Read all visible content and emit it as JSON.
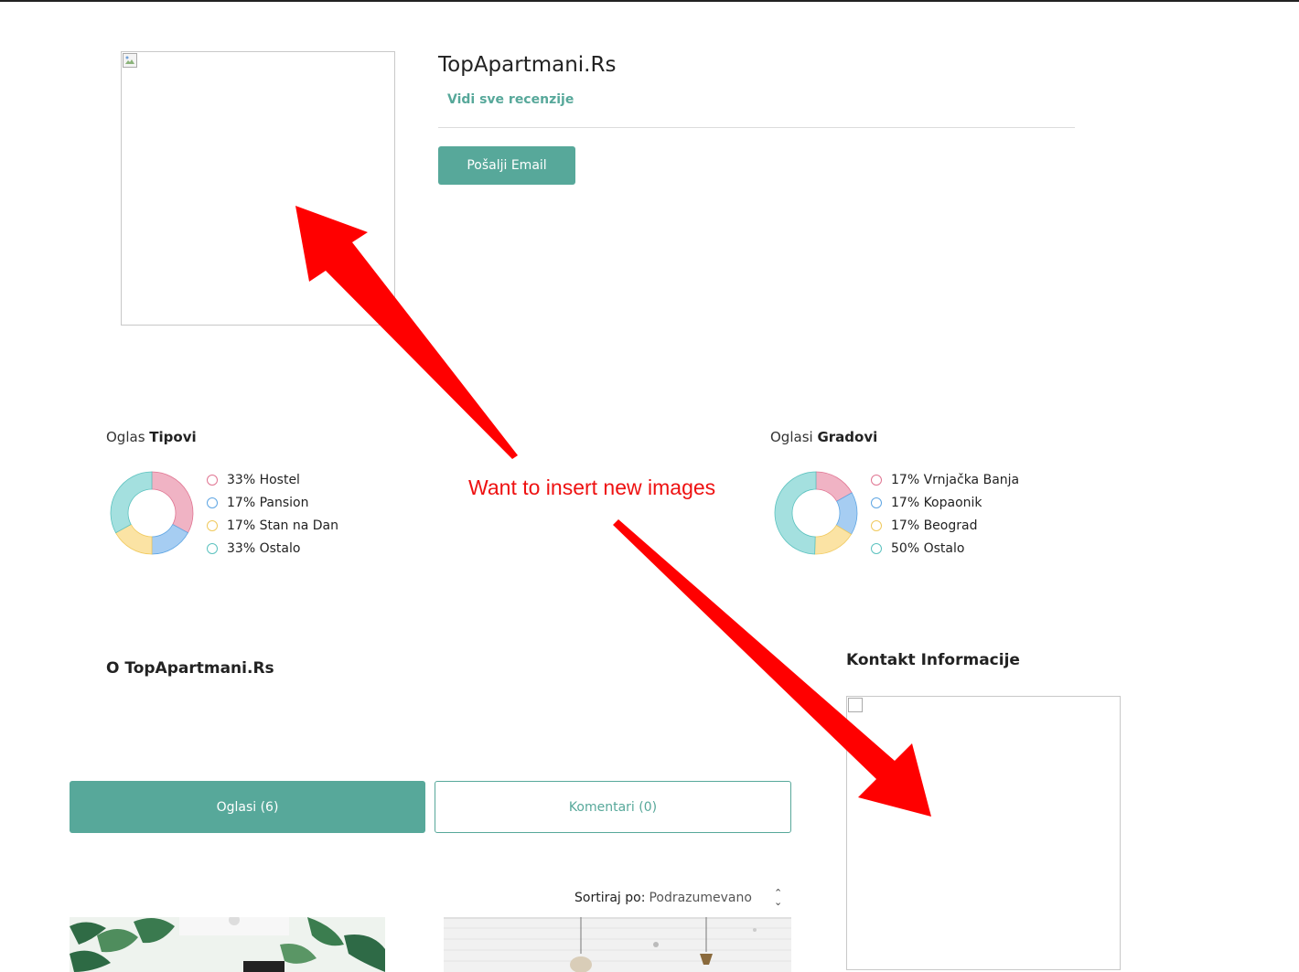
{
  "profile": {
    "name": "TopApartmani.Rs",
    "reviews_link": "Vidi sve recenzije",
    "email_button": "Pošalji Email"
  },
  "stats": {
    "types": {
      "title_prefix": "Oglas",
      "title_bold": "Tipovi",
      "items": [
        {
          "label": "33% Hostel",
          "pct": 33,
          "color": "#f0b3c4",
          "border": "#e07592"
        },
        {
          "label": "17% Pansion",
          "pct": 17,
          "color": "#a6cdf2",
          "border": "#5fa6e3"
        },
        {
          "label": "17% Stan na Dan",
          "pct": 17,
          "color": "#fbe3a4",
          "border": "#f0c95d"
        },
        {
          "label": "33% Ostalo",
          "pct": 33,
          "color": "#a4e0df",
          "border": "#5cc2bf"
        }
      ]
    },
    "cities": {
      "title_prefix": "Oglasi",
      "title_bold": "Gradovi",
      "items": [
        {
          "label": "17% Vrnjačka Banja",
          "pct": 17,
          "color": "#f0b3c4",
          "border": "#e07592"
        },
        {
          "label": "17% Kopaonik",
          "pct": 17,
          "color": "#a6cdf2",
          "border": "#5fa6e3"
        },
        {
          "label": "17% Beograd",
          "pct": 17,
          "color": "#fbe3a4",
          "border": "#f0c95d"
        },
        {
          "label": "50% Ostalo",
          "pct": 50,
          "color": "#a4e0df",
          "border": "#5cc2bf"
        }
      ]
    }
  },
  "about": {
    "title": "O TopApartmani.Rs"
  },
  "contact": {
    "title": "Kontakt Informacije"
  },
  "tabs": [
    {
      "label": "Oglasi (6)",
      "active": true
    },
    {
      "label": "Komentari (0)",
      "active": false
    }
  ],
  "sort": {
    "label": "Sortiraj po:",
    "value": "Podrazumevano"
  },
  "annotation": {
    "text": "Want to insert new images",
    "color": "#ee1111"
  },
  "accent_color": "#57a89a"
}
